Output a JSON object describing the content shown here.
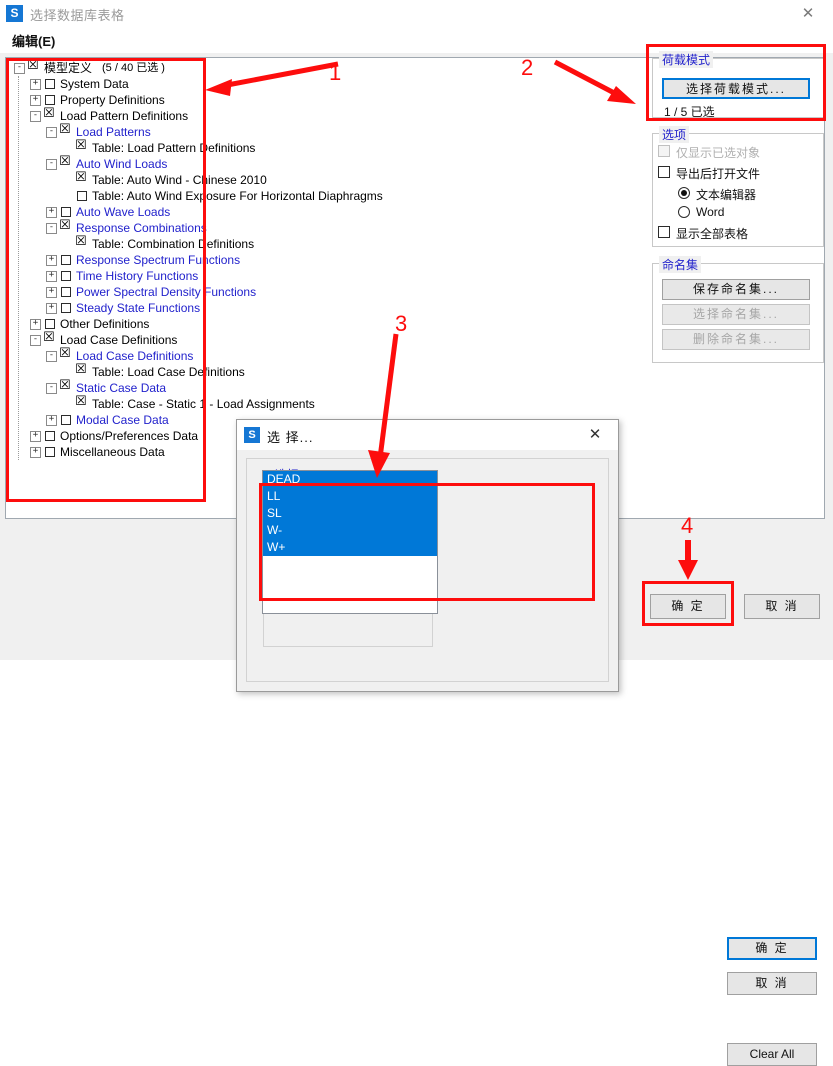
{
  "window": {
    "title": "选择数据库表格",
    "icon": "S",
    "close_icon": "✕",
    "menu": {
      "edit": "编辑(E)"
    }
  },
  "tree": {
    "root": {
      "label": "模型定义",
      "count_text": "(5 / 40 已选 )"
    },
    "items": [
      {
        "label": "System Data",
        "level": 1,
        "checked": false,
        "color": "black",
        "expander": "+"
      },
      {
        "label": "Property Definitions",
        "level": 1,
        "checked": false,
        "color": "black",
        "expander": "+"
      },
      {
        "label": "Load Pattern Definitions",
        "level": 1,
        "checked": true,
        "color": "black",
        "expander": "-"
      },
      {
        "label": "Load Patterns",
        "level": 2,
        "checked": true,
        "color": "blue",
        "expander": "-"
      },
      {
        "label": "Table:  Load Pattern Definitions",
        "level": 3,
        "checked": true,
        "color": "black",
        "expander": ""
      },
      {
        "label": "Auto Wind Loads",
        "level": 2,
        "checked": true,
        "color": "blue",
        "expander": "-"
      },
      {
        "label": "Table:  Auto Wind - Chinese 2010",
        "level": 3,
        "checked": true,
        "color": "black",
        "expander": ""
      },
      {
        "label": "Table:  Auto Wind Exposure For Horizontal Diaphragms",
        "level": 3,
        "checked": false,
        "color": "black",
        "expander": ""
      },
      {
        "label": "Auto Wave Loads",
        "level": 2,
        "checked": false,
        "color": "blue",
        "expander": "+"
      },
      {
        "label": "Response Combinations",
        "level": 2,
        "checked": true,
        "color": "blue",
        "expander": "-"
      },
      {
        "label": "Table:  Combination Definitions",
        "level": 3,
        "checked": true,
        "color": "black",
        "expander": ""
      },
      {
        "label": "Response Spectrum Functions",
        "level": 2,
        "checked": false,
        "color": "blue",
        "expander": "+"
      },
      {
        "label": "Time History Functions",
        "level": 2,
        "checked": false,
        "color": "blue",
        "expander": "+"
      },
      {
        "label": "Power Spectral Density Functions",
        "level": 2,
        "checked": false,
        "color": "blue",
        "expander": "+"
      },
      {
        "label": "Steady State Functions",
        "level": 2,
        "checked": false,
        "color": "blue",
        "expander": "+"
      },
      {
        "label": "Other Definitions",
        "level": 1,
        "checked": false,
        "color": "black",
        "expander": "+"
      },
      {
        "label": "Load Case Definitions",
        "level": 1,
        "checked": true,
        "color": "black",
        "expander": "-"
      },
      {
        "label": "Load Case Definitions",
        "level": 2,
        "checked": true,
        "color": "blue",
        "expander": "-"
      },
      {
        "label": "Table:  Load Case Definitions",
        "level": 3,
        "checked": true,
        "color": "black",
        "expander": ""
      },
      {
        "label": "Static Case Data",
        "level": 2,
        "checked": true,
        "color": "blue",
        "expander": "-"
      },
      {
        "label": "Table:  Case - Static 1 - Load Assignments",
        "level": 3,
        "checked": true,
        "color": "black",
        "expander": ""
      },
      {
        "label": "Modal Case Data",
        "level": 2,
        "checked": false,
        "color": "blue",
        "expander": "+"
      },
      {
        "label": "Options/Preferences Data",
        "level": 1,
        "checked": false,
        "color": "black",
        "expander": "+"
      },
      {
        "label": "Miscellaneous Data",
        "level": 1,
        "checked": false,
        "color": "black",
        "expander": "+"
      }
    ]
  },
  "load_mode": {
    "group_title": "荷载模式",
    "button_label": "选择荷载模式...",
    "status": "1 / 5 已选"
  },
  "options": {
    "group_title": "选项",
    "only_selected": {
      "label": "仅显示已选对象",
      "checked": false,
      "enabled": false
    },
    "open_after_export": {
      "label": "导出后打开文件",
      "checked": false,
      "enabled": true
    },
    "radio_text_editor": {
      "label": "文本编辑器",
      "selected": true
    },
    "radio_word": {
      "label": "Word",
      "selected": false
    },
    "show_all_tables": {
      "label": "显示全部表格",
      "checked": false
    }
  },
  "named_sets": {
    "group_title": "命名集",
    "save": {
      "label": "保存命名集...",
      "enabled": true
    },
    "select": {
      "label": "选择命名集...",
      "enabled": false
    },
    "delete": {
      "label": "删除命名集...",
      "enabled": false
    }
  },
  "footer": {
    "ok": "确 定",
    "cancel": "取 消"
  },
  "modal": {
    "icon": "S",
    "title": "选 择...",
    "close_icon": "✕",
    "group_title": "选择",
    "list_items": [
      {
        "label": "DEAD",
        "selected": true
      },
      {
        "label": "LL",
        "selected": true
      },
      {
        "label": "SL",
        "selected": true
      },
      {
        "label": "W-",
        "selected": true
      },
      {
        "label": "W+",
        "selected": true
      }
    ],
    "ok": "确 定",
    "cancel": "取 消",
    "clear_all": "Clear All"
  },
  "annotations": {
    "numbers": [
      "1",
      "2",
      "3",
      "4"
    ],
    "color": "#fd0d0d"
  }
}
